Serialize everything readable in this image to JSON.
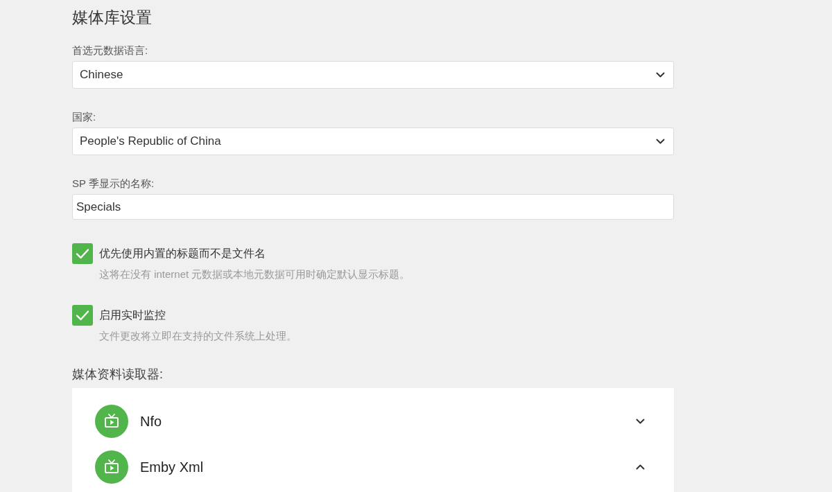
{
  "page": {
    "title": "媒体库设置"
  },
  "fields": [
    {
      "kind": "select",
      "label": "首选元数据语言:",
      "value": "Chinese"
    },
    {
      "kind": "select",
      "label": "国家:",
      "value": "People's Republic of China"
    },
    {
      "kind": "text",
      "label": "SP 季显示的名称:",
      "value": "Specials"
    }
  ],
  "options": [
    {
      "label": "优先使用内置的标题而不是文件名",
      "description": "这将在没有 internet 元数据或本地元数据可用时确定默认显示标题。",
      "checked": true
    },
    {
      "label": "启用实时监控",
      "description": "文件更改将立即在支持的文件系统上处理。",
      "checked": true
    }
  ],
  "metadata_readers": {
    "label": "媒体资料读取器:",
    "items": [
      {
        "name": "Nfo",
        "expanded": false
      },
      {
        "name": "Emby Xml",
        "expanded": true
      }
    ]
  }
}
